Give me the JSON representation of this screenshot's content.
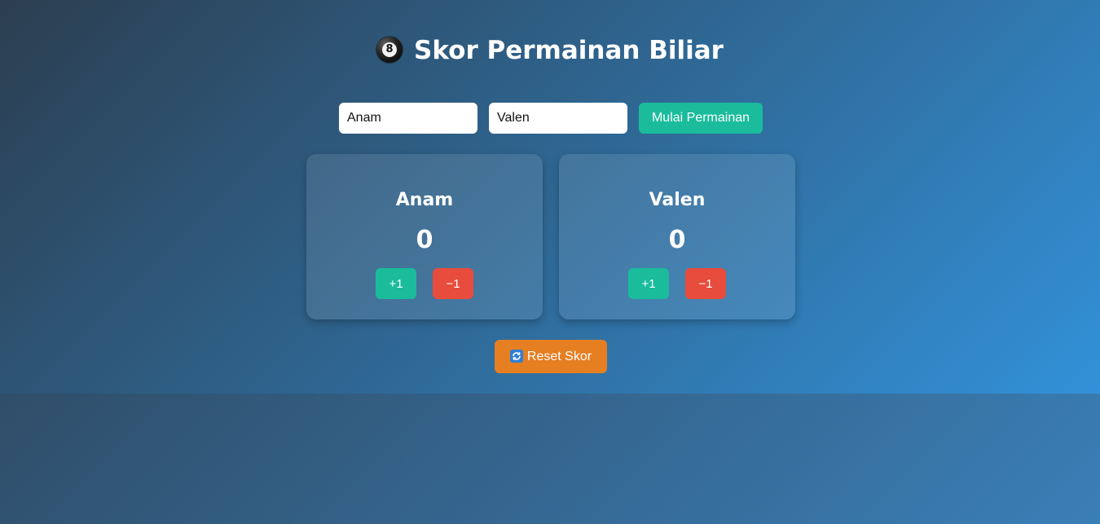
{
  "header": {
    "title": "Skor Permainan Biliar",
    "icon": "8-ball-icon",
    "ball_number": "8"
  },
  "setup": {
    "player1_value": "Anam",
    "player2_value": "Valen",
    "start_label": "Mulai Permainan"
  },
  "players": [
    {
      "name": "Anam",
      "score": "0",
      "plus_label": "+1",
      "minus_label": "−1"
    },
    {
      "name": "Valen",
      "score": "0",
      "plus_label": "+1",
      "minus_label": "−1"
    }
  ],
  "reset": {
    "label": "Reset Skor",
    "icon": "refresh-icon"
  },
  "colors": {
    "accent_green": "#1abc9c",
    "danger_red": "#e74c3c",
    "reset_orange": "#e67e22"
  }
}
